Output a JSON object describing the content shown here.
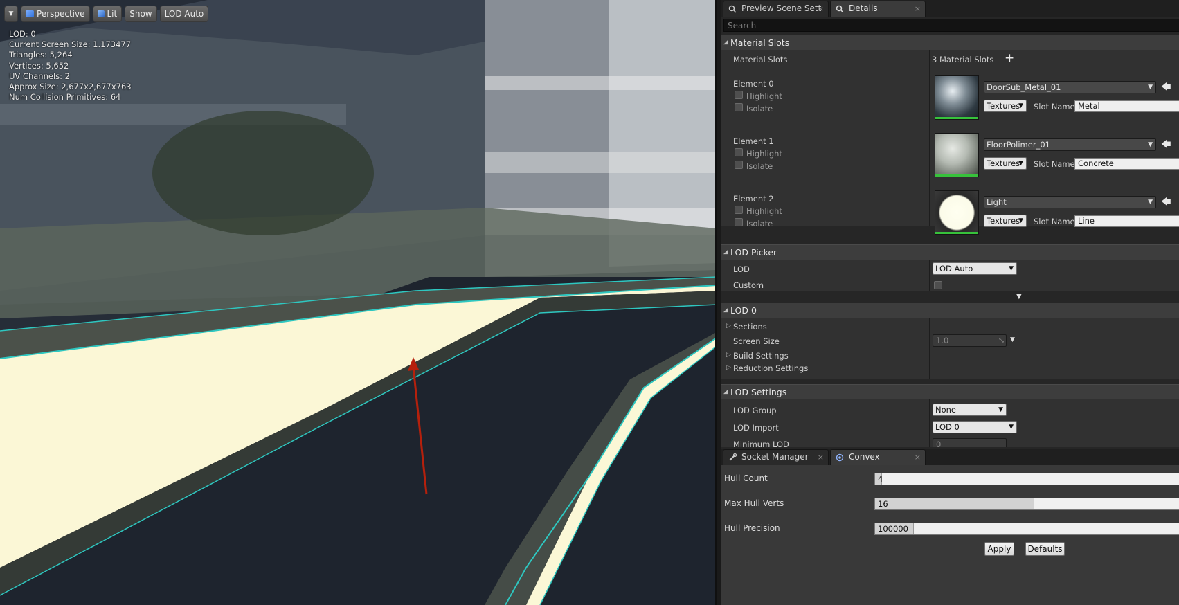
{
  "viewport": {
    "toolbar": {
      "menu_icon": "dropdown-arrow-icon",
      "perspective": "Perspective",
      "lit": "Lit",
      "show": "Show",
      "lod": "LOD Auto"
    },
    "stats": {
      "lod": "LOD:  0",
      "screen_size": "Current Screen Size:  1.173477",
      "triangles": "Triangles:  5,264",
      "vertices": "Vertices:  5,652",
      "uv_channels": "UV Channels:  2",
      "approx_size": "Approx Size:  2,677x2,677x763",
      "collision": "Num Collision Primitives:  64"
    }
  },
  "top_tabs": {
    "preview": "Preview Scene Sett",
    "details": "Details"
  },
  "details": {
    "search_placeholder": "Search",
    "material_slots": {
      "header": "Material Slots",
      "label": "Material Slots",
      "count": "3 Material Slots",
      "add_icon": "plus-icon",
      "elements": [
        {
          "name": "Element 0",
          "highlight": "Highlight",
          "isolate": "Isolate",
          "material": "DoorSub_Metal_01",
          "textures": "Textures",
          "slot_label": "Slot Name",
          "slot_name": "Metal"
        },
        {
          "name": "Element 1",
          "highlight": "Highlight",
          "isolate": "Isolate",
          "material": "FloorPolimer_01",
          "textures": "Textures",
          "slot_label": "Slot Name",
          "slot_name": "Concrete"
        },
        {
          "name": "Element 2",
          "highlight": "Highlight",
          "isolate": "Isolate",
          "material": "Light",
          "textures": "Textures",
          "slot_label": "Slot Name",
          "slot_name": "Line"
        }
      ]
    },
    "lod_picker": {
      "header": "LOD Picker",
      "lod_label": "LOD",
      "lod_value": "LOD Auto",
      "custom_label": "Custom"
    },
    "lod0": {
      "header": "LOD 0",
      "sections": "Sections",
      "screen_size_label": "Screen Size",
      "screen_size_value": "1.0",
      "build_settings": "Build Settings",
      "reduction_settings": "Reduction Settings"
    },
    "lod_settings": {
      "header": "LOD Settings",
      "lod_group_label": "LOD Group",
      "lod_group_value": "None",
      "lod_import_label": "LOD Import",
      "lod_import_value": "LOD 0",
      "min_lod_label": "Minimum LOD",
      "min_lod_value": "0"
    }
  },
  "bottom_tabs": {
    "socket": "Socket Manager",
    "convex": "Convex Decompos"
  },
  "convex": {
    "hull_count_label": "Hull Count",
    "hull_count": "4",
    "hull_count_fraction": 0.02,
    "max_hull_verts_label": "Max Hull Verts",
    "max_hull_verts": "16",
    "max_hull_verts_fraction": 0.5,
    "hull_precision_label": "Hull Precision",
    "hull_precision": "100000",
    "hull_precision_fraction": 0.12,
    "apply": "Apply",
    "defaults": "Defaults"
  }
}
